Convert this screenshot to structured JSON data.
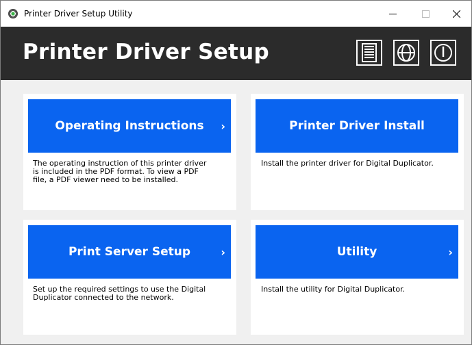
{
  "window": {
    "title": "Printer Driver Setup Utility",
    "controls": {
      "minimize": "minimize-icon",
      "maximize": "maximize-icon",
      "close": "close-icon"
    }
  },
  "header": {
    "title": "Printer Driver Setup",
    "icons": [
      "document-icon",
      "globe-icon",
      "power-icon"
    ],
    "background": "#2b2b2b"
  },
  "cards": [
    {
      "label": "Operating Instructions",
      "chevron": "›",
      "description": "The operating instruction of this printer driver\nis included in the PDF format. To view a PDF\nfile, a PDF viewer need to be installed."
    },
    {
      "label": "Printer Driver Install",
      "chevron": "",
      "description": "Install the printer driver for Digital Duplicator."
    },
    {
      "label": "Print Server Setup",
      "chevron": "›",
      "description": "Set up the required settings to use the Digital\nDuplicator connected to the network."
    },
    {
      "label": "Utility",
      "chevron": "›",
      "description": "Install the utility for Digital Duplicator."
    }
  ],
  "colors": {
    "accent": "#0a64f0",
    "page": "#f0f0f0",
    "card": "#ffffff"
  }
}
